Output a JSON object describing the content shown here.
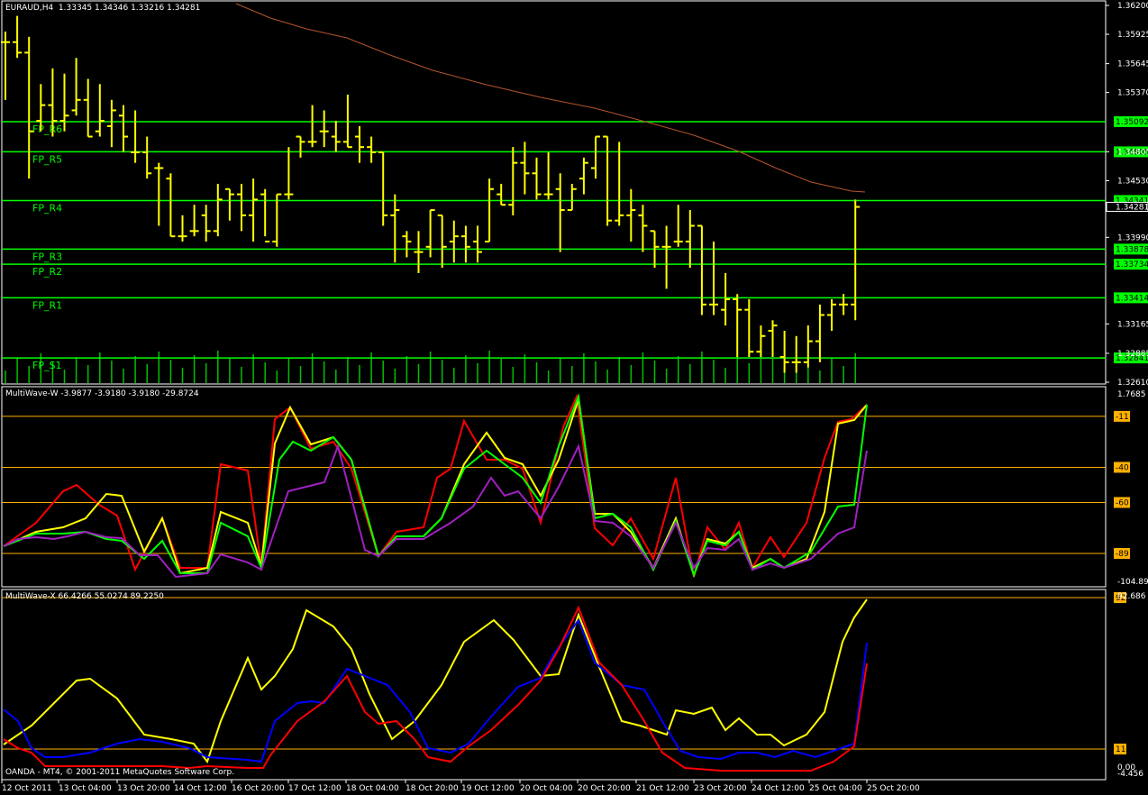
{
  "colors": {
    "background": "#000000",
    "frame": "#ffffff",
    "bars": "#ffff00",
    "pivots": "#00ff00",
    "ma": "#b5552c",
    "volume": "#00c000",
    "mw_levels": "#ffb000",
    "mw_red": "#ff0000",
    "mw_yellow": "#ffff00",
    "mw_green": "#00ff00",
    "mw_purple": "#a020c0",
    "mx_blue": "#0000ff",
    "mx_red": "#ff0000",
    "mx_yellow": "#ffff00"
  },
  "main": {
    "title": "EURAUD,H4  1.33345 1.34346 1.33216 1.34281",
    "price_axis": [
      "1.36200",
      "1.35925",
      "1.35645",
      "1.35370",
      "1.34805",
      "1.34530",
      "1.33990",
      "1.33165",
      "1.32885",
      "1.32610"
    ],
    "current_price": "1.34281",
    "pivots": [
      {
        "name": "FP_R6",
        "value": "1.35092"
      },
      {
        "name": "FP_R5",
        "value": "1.34805"
      },
      {
        "name": "FP_R4",
        "value": "1.34341"
      },
      {
        "name": "FP_R3",
        "value": "1.33878"
      },
      {
        "name": "FP_R2",
        "value": "1.33734"
      },
      {
        "name": "FP_R1",
        "value": "1.33414"
      },
      {
        "name": "FP_S1",
        "value": "1.32841"
      }
    ]
  },
  "w": {
    "title": "MultiWave-W -3.9877 -3.9180 -3.9180 -29.8724",
    "top": "1.7685",
    "bottom": "-104.896",
    "levels": [
      "-11",
      "-40",
      "-60",
      "-89"
    ]
  },
  "x": {
    "title": "MultiWave-X 66.4266 55.0274 89.2250",
    "top": "92.686",
    "bottom": "0.00",
    "bottom2": "-4.456",
    "levels": [
      "92",
      "11"
    ]
  },
  "copyright": "OANDA - MT4, © 2001-2011 MetaQuotes Software Corp.",
  "time_axis": [
    "12 Oct 2011",
    "13 Oct 04:00",
    "13 Oct 20:00",
    "14 Oct 12:00",
    "16 Oct 20:00",
    "17 Oct 12:00",
    "18 Oct 04:00",
    "18 Oct 20:00",
    "19 Oct 12:00",
    "20 Oct 04:00",
    "20 Oct 20:00",
    "21 Oct 12:00",
    "23 Oct 20:00",
    "24 Oct 12:00",
    "25 Oct 04:00",
    "25 Oct 20:00"
  ],
  "chart_data": {
    "type": "ohlc",
    "symbol": "EURAUD",
    "timeframe": "H4",
    "ylim": [
      1.3261,
      1.362
    ],
    "series": [
      {
        "name": "EURAUD",
        "values": [
          [
            1.3585,
            1.3595,
            1.353,
            1.3585
          ],
          [
            1.3585,
            1.361,
            1.357,
            1.3575
          ],
          [
            1.3575,
            1.359,
            1.3455,
            1.35
          ],
          [
            1.351,
            1.3545,
            1.35,
            1.3525
          ],
          [
            1.3525,
            1.356,
            1.3495,
            1.351
          ],
          [
            1.351,
            1.3555,
            1.35,
            1.3515
          ],
          [
            1.352,
            1.357,
            1.3515,
            1.353
          ],
          [
            1.353,
            1.355,
            1.3495,
            1.3495
          ],
          [
            1.35,
            1.3545,
            1.3495,
            1.351
          ],
          [
            1.3505,
            1.353,
            1.3485,
            1.352
          ],
          [
            1.3515,
            1.3525,
            1.348,
            1.3495
          ],
          [
            1.348,
            1.352,
            1.347,
            1.348
          ],
          [
            1.348,
            1.3495,
            1.3455,
            1.346
          ],
          [
            1.3465,
            1.347,
            1.341,
            1.3465
          ],
          [
            1.3455,
            1.346,
            1.34,
            1.34
          ],
          [
            1.34,
            1.342,
            1.3395,
            1.34
          ],
          [
            1.3405,
            1.343,
            1.34,
            1.3405
          ],
          [
            1.342,
            1.343,
            1.3395,
            1.3405
          ],
          [
            1.3405,
            1.345,
            1.34,
            1.3435
          ],
          [
            1.3445,
            1.3445,
            1.3415,
            1.344
          ],
          [
            1.344,
            1.345,
            1.3405,
            1.342
          ],
          [
            1.342,
            1.3455,
            1.3395,
            1.3435
          ],
          [
            1.344,
            1.3445,
            1.34,
            1.3395
          ],
          [
            1.3395,
            1.344,
            1.339,
            1.344
          ],
          [
            1.344,
            1.3485,
            1.3435,
            1.344
          ],
          [
            1.3495,
            1.3495,
            1.3475,
            1.349
          ],
          [
            1.349,
            1.3525,
            1.3485,
            1.349
          ],
          [
            1.35,
            1.352,
            1.3485,
            1.35
          ],
          [
            1.3495,
            1.351,
            1.348,
            1.349
          ],
          [
            1.349,
            1.3535,
            1.3485,
            1.3485
          ],
          [
            1.3495,
            1.3505,
            1.347,
            1.3485
          ],
          [
            1.3485,
            1.3495,
            1.347,
            1.348
          ],
          [
            1.348,
            1.348,
            1.341,
            1.342
          ],
          [
            1.342,
            1.344,
            1.3375,
            1.3425
          ],
          [
            1.34,
            1.3405,
            1.338,
            1.3395
          ],
          [
            1.3385,
            1.3405,
            1.3365,
            1.3385
          ],
          [
            1.339,
            1.3425,
            1.338,
            1.3425
          ],
          [
            1.342,
            1.342,
            1.337,
            1.339
          ],
          [
            1.3395,
            1.3415,
            1.3375,
            1.34
          ],
          [
            1.34,
            1.341,
            1.3375,
            1.339
          ],
          [
            1.3395,
            1.341,
            1.3375,
            1.3385
          ],
          [
            1.3395,
            1.3455,
            1.3395,
            1.3445
          ],
          [
            1.344,
            1.345,
            1.343,
            1.343
          ],
          [
            1.343,
            1.3485,
            1.342,
            1.347
          ],
          [
            1.347,
            1.349,
            1.344,
            1.346
          ],
          [
            1.346,
            1.3475,
            1.3435,
            1.344
          ],
          [
            1.344,
            1.348,
            1.3435,
            1.344
          ],
          [
            1.3445,
            1.346,
            1.3385,
            1.3425
          ],
          [
            1.3425,
            1.345,
            1.3425,
            1.3445
          ],
          [
            1.3455,
            1.3475,
            1.344,
            1.347
          ],
          [
            1.3465,
            1.3495,
            1.3455,
            1.3495
          ],
          [
            1.3495,
            1.3495,
            1.341,
            1.3415
          ],
          [
            1.3415,
            1.349,
            1.341,
            1.342
          ],
          [
            1.342,
            1.3445,
            1.3395,
            1.3425
          ],
          [
            1.342,
            1.343,
            1.3385,
            1.341
          ],
          [
            1.3405,
            1.3405,
            1.337,
            1.339
          ],
          [
            1.339,
            1.341,
            1.335,
            1.339
          ],
          [
            1.3395,
            1.343,
            1.339,
            1.3395
          ],
          [
            1.3395,
            1.3425,
            1.337,
            1.341
          ],
          [
            1.341,
            1.341,
            1.3325,
            1.3335
          ],
          [
            1.3335,
            1.3395,
            1.3325,
            1.3335
          ],
          [
            1.333,
            1.3365,
            1.3315,
            1.334
          ],
          [
            1.334,
            1.3345,
            1.3285,
            1.333
          ],
          [
            1.333,
            1.334,
            1.3285,
            1.329
          ],
          [
            1.329,
            1.3315,
            1.3285,
            1.3305
          ],
          [
            1.331,
            1.332,
            1.3285,
            1.3315
          ],
          [
            1.3285,
            1.331,
            1.327,
            1.328
          ],
          [
            1.328,
            1.3305,
            1.327,
            1.328
          ],
          [
            1.328,
            1.3315,
            1.3275,
            1.33
          ],
          [
            1.33,
            1.3335,
            1.328,
            1.3325
          ],
          [
            1.3325,
            1.334,
            1.331,
            1.3335
          ],
          [
            1.3335,
            1.3345,
            1.3325,
            1.3335
          ],
          [
            1.3335,
            1.3435,
            1.332,
            1.3428
          ]
        ]
      }
    ]
  }
}
